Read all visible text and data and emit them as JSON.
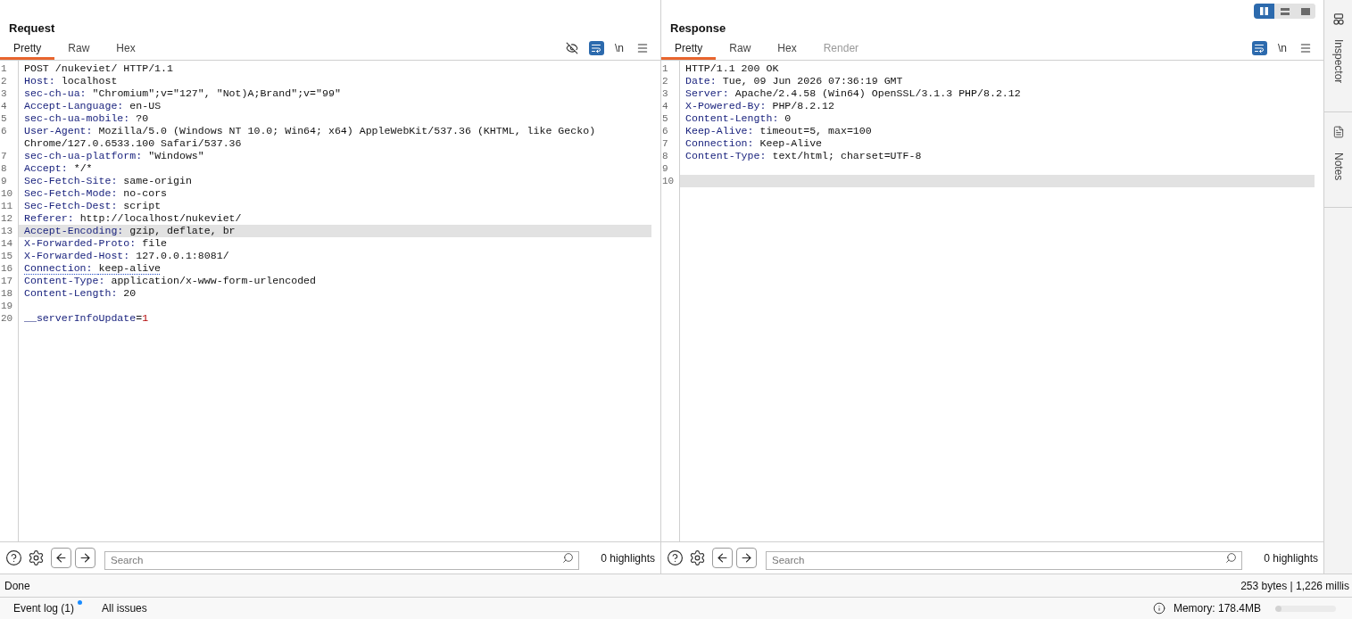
{
  "view_toggle": [
    {
      "kind": "columns",
      "selected": true
    },
    {
      "kind": "rows",
      "selected": false
    },
    {
      "kind": "single",
      "selected": false
    }
  ],
  "panes": [
    {
      "title": "Request",
      "tabs": [
        {
          "label": "Pretty",
          "selected": true,
          "disabled": false
        },
        {
          "label": "Raw",
          "selected": false,
          "disabled": false
        },
        {
          "label": "Hex",
          "selected": false,
          "disabled": false
        }
      ],
      "tools": [
        {
          "kind": "hide",
          "on": false
        },
        {
          "kind": "wrap",
          "on": true
        },
        {
          "kind": "newline",
          "label": "\\n",
          "on": false
        },
        {
          "kind": "menu"
        }
      ],
      "lines": [
        {
          "number": "1",
          "kind": "start",
          "text": "POST /nukeviet/ HTTP/1.1",
          "highlighted": false,
          "underlined": false
        },
        {
          "number": "2",
          "kind": "header",
          "name": "Host:",
          "value": "localhost",
          "highlighted": false,
          "underlined": false
        },
        {
          "number": "3",
          "kind": "header",
          "name": "sec-ch-ua:",
          "value": "\"Chromium\";v=\"127\", \"Not)A;Brand\";v=\"99\"",
          "highlighted": false,
          "underlined": false
        },
        {
          "number": "4",
          "kind": "header",
          "name": "Accept-Language:",
          "value": "en-US",
          "highlighted": false,
          "underlined": false
        },
        {
          "number": "5",
          "kind": "header",
          "name": "sec-ch-ua-mobile:",
          "value": "?0",
          "highlighted": false,
          "underlined": false
        },
        {
          "number": "6",
          "kind": "header",
          "name": "User-Agent:",
          "value": "Mozilla/5.0 (Windows NT 10.0; Win64; x64) AppleWebKit/537.36 (KHTML, like Gecko) Chrome/127.0.6533.100 Safari/537.36",
          "highlighted": false,
          "underlined": false
        },
        {
          "number": "7",
          "kind": "header",
          "name": "sec-ch-ua-platform:",
          "value": "\"Windows\"",
          "highlighted": false,
          "underlined": false
        },
        {
          "number": "8",
          "kind": "header",
          "name": "Accept:",
          "value": "*/*",
          "highlighted": false,
          "underlined": false
        },
        {
          "number": "9",
          "kind": "header",
          "name": "Sec-Fetch-Site:",
          "value": "same-origin",
          "highlighted": false,
          "underlined": false
        },
        {
          "number": "10",
          "kind": "header",
          "name": "Sec-Fetch-Mode:",
          "value": "no-cors",
          "highlighted": false,
          "underlined": false
        },
        {
          "number": "11",
          "kind": "header",
          "name": "Sec-Fetch-Dest:",
          "value": "script",
          "highlighted": false,
          "underlined": false
        },
        {
          "number": "12",
          "kind": "header",
          "name": "Referer:",
          "value": "http://localhost/nukeviet/",
          "highlighted": false,
          "underlined": false
        },
        {
          "number": "13",
          "kind": "header",
          "name": "Accept-Encoding:",
          "value": "gzip, deflate, br",
          "highlighted": true,
          "underlined": false
        },
        {
          "number": "14",
          "kind": "header",
          "name": "X-Forwarded-Proto:",
          "value": "file",
          "highlighted": false,
          "underlined": false
        },
        {
          "number": "15",
          "kind": "header",
          "name": "X-Forwarded-Host:",
          "value": "127.0.0.1:8081/",
          "highlighted": false,
          "underlined": false
        },
        {
          "number": "16",
          "kind": "header",
          "name": "Connection:",
          "value": "keep-alive",
          "highlighted": false,
          "underlined": true
        },
        {
          "number": "17",
          "kind": "header",
          "name": "Content-Type:",
          "value": "application/x-www-form-urlencoded",
          "highlighted": false,
          "underlined": false
        },
        {
          "number": "18",
          "kind": "header",
          "name": "Content-Length:",
          "value": "20",
          "highlighted": false,
          "underlined": false
        },
        {
          "number": "19",
          "kind": "blank",
          "highlighted": false
        },
        {
          "number": "20",
          "kind": "param",
          "name": "__serverInfoUpdate",
          "operator": "=",
          "value": "1",
          "highlighted": false,
          "underlined": false
        }
      ],
      "search": {
        "placeholder": "Search"
      },
      "highlights": "0 highlights"
    },
    {
      "title": "Response",
      "tabs": [
        {
          "label": "Pretty",
          "selected": true,
          "disabled": false
        },
        {
          "label": "Raw",
          "selected": false,
          "disabled": false
        },
        {
          "label": "Hex",
          "selected": false,
          "disabled": false
        },
        {
          "label": "Render",
          "selected": false,
          "disabled": true
        }
      ],
      "tools": [
        {
          "kind": "wrap",
          "on": true
        },
        {
          "kind": "newline",
          "label": "\\n",
          "on": false
        },
        {
          "kind": "menu"
        }
      ],
      "lines": [
        {
          "number": "1",
          "kind": "start",
          "text": "HTTP/1.1 200 OK",
          "highlighted": false,
          "underlined": false
        },
        {
          "number": "2",
          "kind": "header",
          "name": "Date:",
          "value": "Tue, 09 Jun 2026 07:36:19 GMT",
          "highlighted": false,
          "underlined": false
        },
        {
          "number": "3",
          "kind": "header",
          "name": "Server:",
          "value": "Apache/2.4.58 (Win64) OpenSSL/3.1.3 PHP/8.2.12",
          "highlighted": false,
          "underlined": false
        },
        {
          "number": "4",
          "kind": "header",
          "name": "X-Powered-By:",
          "value": "PHP/8.2.12",
          "highlighted": false,
          "underlined": false
        },
        {
          "number": "5",
          "kind": "header",
          "name": "Content-Length:",
          "value": "0",
          "highlighted": false,
          "underlined": false
        },
        {
          "number": "6",
          "kind": "header",
          "name": "Keep-Alive:",
          "value": "timeout=5, max=100",
          "highlighted": false,
          "underlined": false
        },
        {
          "number": "7",
          "kind": "header",
          "name": "Connection:",
          "value": "Keep-Alive",
          "highlighted": false,
          "underlined": false
        },
        {
          "number": "8",
          "kind": "header",
          "name": "Content-Type:",
          "value": "text/html; charset=UTF-8",
          "highlighted": false,
          "underlined": false
        },
        {
          "number": "9",
          "kind": "blank",
          "highlighted": false
        },
        {
          "number": "10",
          "kind": "blank",
          "highlighted": true
        }
      ],
      "search": {
        "placeholder": "Search"
      },
      "highlights": "0 highlights"
    }
  ],
  "sidebar": {
    "tabs": [
      {
        "kind": "inspector",
        "label": "Inspector"
      },
      {
        "kind": "notes",
        "label": "Notes"
      }
    ]
  },
  "status_bar": {
    "message": "Done",
    "stats": "253 bytes | 1,226 millis"
  },
  "bottom_bar": {
    "tabs": [
      {
        "label": "Event log (1)",
        "unread": true
      },
      {
        "label": "All issues",
        "unread": false
      }
    ],
    "memory": {
      "label": "Memory: 178.4MB",
      "level": 0.1
    }
  }
}
